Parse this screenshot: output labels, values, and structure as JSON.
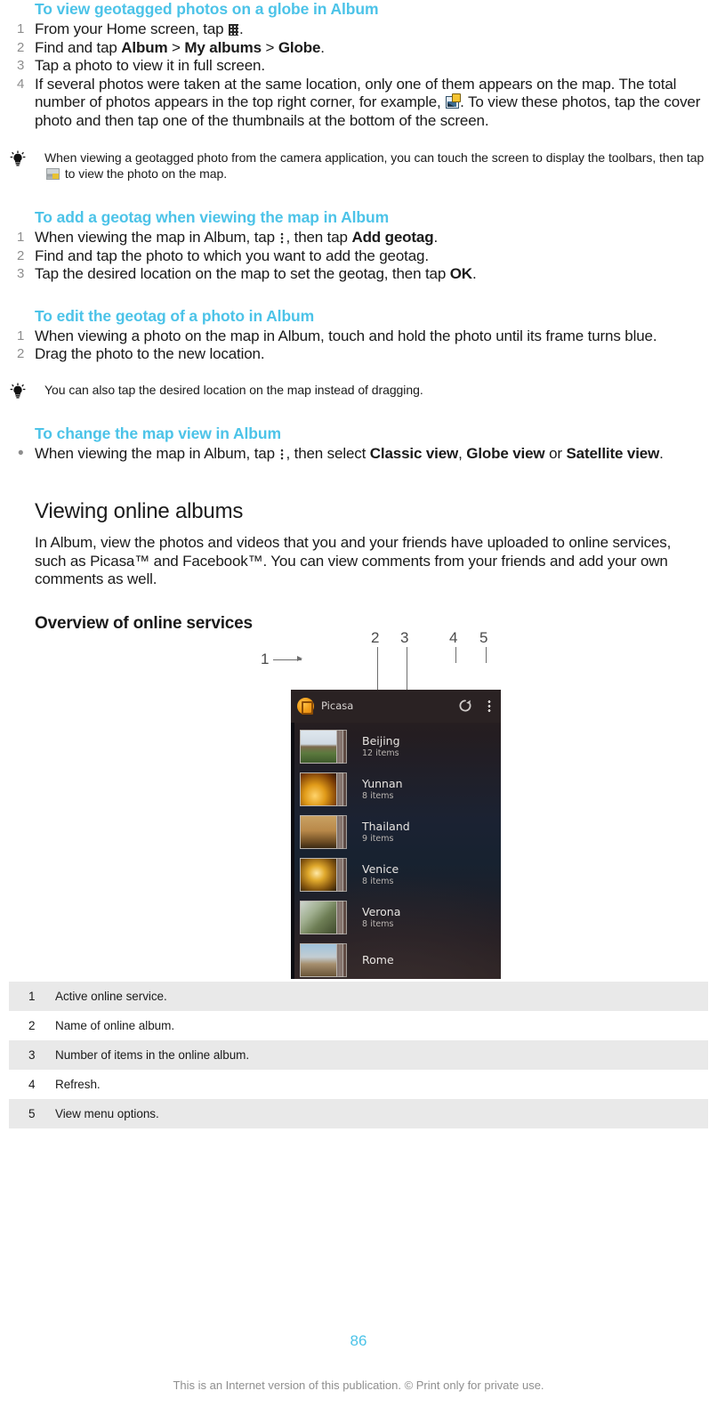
{
  "sections": {
    "geotag_globe": {
      "heading": "To view geotagged photos on a globe in Album",
      "steps": [
        {
          "num": "1",
          "pre": "From your Home screen, tap ",
          "icon": "app-drawer-grid-icon",
          "post": "."
        },
        {
          "num": "2",
          "pre": "Find and tap ",
          "b1": "Album",
          "mid1": " > ",
          "b2": "My albums",
          "mid2": " > ",
          "b3": "Globe",
          "post": "."
        },
        {
          "num": "3",
          "pre": "Tap a photo to view it in full screen.",
          "post": ""
        },
        {
          "num": "4",
          "pre": "If several photos were taken at the same location, only one of them appears on the map. The total number of photos appears in the top right corner, for example, ",
          "icon": "photo-badge-icon",
          "post": ". To view these photos, tap the cover photo and then tap one of the thumbnails at the bottom of the screen."
        }
      ]
    },
    "tip_camera": {
      "icon": "lightbulb-tip-icon",
      "pre": "When viewing a geotagged photo from the camera application, you can touch the screen to display the toolbars, then tap ",
      "icon_inline": "map-photo-icon",
      "post": " to view the photo on the map."
    },
    "add_geotag": {
      "heading": "To add a geotag when viewing the map in Album",
      "steps": [
        {
          "num": "1",
          "pre": "When viewing the map in Album, tap ",
          "icon": "overflow-menu-icon",
          "mid": ", then tap ",
          "b1": "Add geotag",
          "post": "."
        },
        {
          "num": "2",
          "pre": "Find and tap the photo to which you want to add the geotag.",
          "post": ""
        },
        {
          "num": "3",
          "pre": "Tap the desired location on the map to set the geotag, then tap ",
          "b1": "OK",
          "post": "."
        }
      ]
    },
    "edit_geotag": {
      "heading": "To edit the geotag of a photo in Album",
      "steps": [
        {
          "num": "1",
          "pre": "When viewing a photo on the map in Album, touch and hold the photo until its frame turns blue.",
          "post": ""
        },
        {
          "num": "2",
          "pre": "Drag the photo to the new location.",
          "post": ""
        }
      ]
    },
    "tip_drag": {
      "icon": "lightbulb-tip-icon",
      "text": "You can also tap the desired location on the map instead of dragging."
    },
    "change_map_view": {
      "heading": "To change the map view in Album",
      "steps": [
        {
          "num": "•",
          "pre": "When viewing the map in Album, tap ",
          "icon": "overflow-menu-icon",
          "mid": ", then select ",
          "b1": "Classic view",
          "mid2": ", ",
          "b2": "Globe view",
          "mid3": " or ",
          "b3": "Satellite view",
          "post": "."
        }
      ]
    },
    "viewing_online": {
      "heading": "Viewing online albums",
      "body": "In Album, view the photos and videos that you and your friends have uploaded to online services, such as Picasa™ and Facebook™. You can view comments from your friends and add your own comments as well."
    },
    "overview": {
      "heading": "Overview of online services"
    }
  },
  "screenshot": {
    "service_name": "Picasa",
    "service_logo_icon": "picasa-logo-icon",
    "refresh_icon": "refresh-icon",
    "overflow_icon": "overflow-menu-icon",
    "albums": [
      {
        "name": "Beijing",
        "count": "12 items",
        "art": "art-beijing"
      },
      {
        "name": "Yunnan",
        "count": "8 items",
        "art": "art-yunnan"
      },
      {
        "name": "Thailand",
        "count": "9 items",
        "art": "art-thailand"
      },
      {
        "name": "Venice",
        "count": "8 items",
        "art": "art-venice"
      },
      {
        "name": "Verona",
        "count": "8 items",
        "art": "art-verona"
      },
      {
        "name": "Rome",
        "count": "",
        "art": "art-rome"
      }
    ],
    "callouts": [
      "1",
      "2",
      "3",
      "4",
      "5"
    ]
  },
  "legend": {
    "rows": [
      {
        "num": "1",
        "text": "Active online service."
      },
      {
        "num": "2",
        "text": "Name of online album."
      },
      {
        "num": "3",
        "text": "Number of items in the online album."
      },
      {
        "num": "4",
        "text": "Refresh."
      },
      {
        "num": "5",
        "text": "View menu options."
      }
    ]
  },
  "footer": {
    "page_number": "86",
    "note": "This is an Internet version of this publication. © Print only for private use."
  },
  "colors": {
    "heading_blue": "#4cc3e8",
    "marker_gray": "#8d8d8d",
    "legend_odd": "#e9e9e9",
    "footer_gray": "#8f8f8f"
  }
}
